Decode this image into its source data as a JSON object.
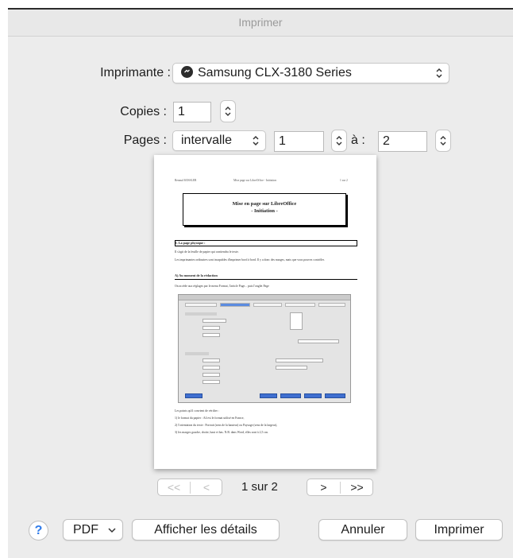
{
  "window": {
    "title": "Imprimer"
  },
  "printer": {
    "label": "Imprimante :",
    "value": "Samsung CLX-3180 Series",
    "icon": "printer-status-icon"
  },
  "copies": {
    "label": "Copies :",
    "value": "1"
  },
  "pages": {
    "label": "Pages :",
    "mode": "intervalle",
    "from": "1",
    "to_label": "à :",
    "to": "2"
  },
  "preview": {
    "header_left": "Renaud KESSLER",
    "header_center": "Mise page sur LibreOffice - Initiation",
    "header_right": "1 sur 2",
    "title_line1": "Mise en page sur LibreOffice",
    "title_line2": "- Initiation -",
    "sec1": "I. La page physique :",
    "p1": "Il s'agit de la feuille de papier qui contiendra le texte.",
    "p2": "Les imprimantes ordinaires sont incapables d'imprimer bord à bord. Il y a donc des marges, mais que vous pouvez contrôler.",
    "sec2": "A) Au moment de la rédaction",
    "p3": "On accède aux réglages par le menu Format, l'article Page... puis l'onglet Page",
    "p4": "Les points qu'il convient de vérifier :",
    "p5": "1) le format du papier : A4 est le format utilisé en France,",
    "p6": "2) l'orientation du texte : Portrait (sens de la hauteur) ou Paysage (sens de la largeur),",
    "p7": "3) les marges gauche, droite, haut et bas. N.B. dans Word, elles sont à 2,5 cm."
  },
  "pager": {
    "first": "<<",
    "prev": "<",
    "status": "1 sur 2",
    "next": ">",
    "last": ">>"
  },
  "footer": {
    "help": "?",
    "pdf": "PDF",
    "details": "Afficher les détails",
    "cancel": "Annuler",
    "print": "Imprimer"
  }
}
